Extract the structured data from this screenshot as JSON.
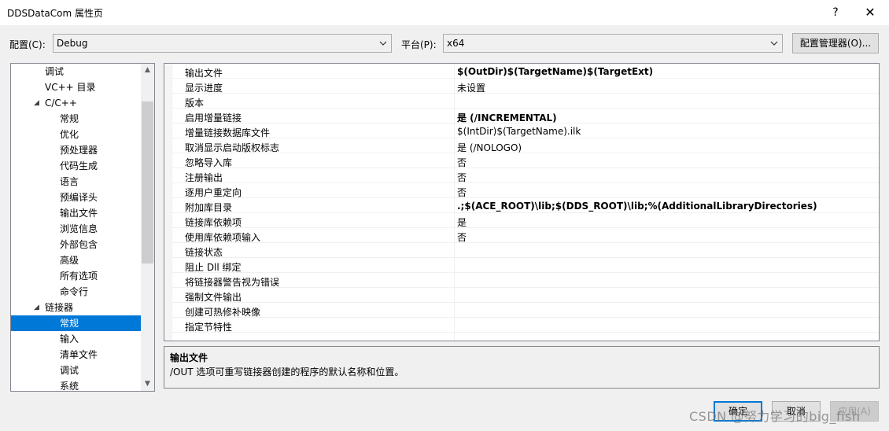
{
  "window": {
    "title": "DDSDataCom 属性页",
    "help_glyph": "?",
    "close_glyph": "✕"
  },
  "config": {
    "label": "配置(C):",
    "value": "Debug",
    "platform_label": "平台(P):",
    "platform_value": "x64",
    "manager_button": "配置管理器(O)..."
  },
  "tree": {
    "items": [
      {
        "label": "调试",
        "indent": 2,
        "expander": "",
        "selected": false
      },
      {
        "label": "VC++ 目录",
        "indent": 2,
        "expander": "",
        "selected": false
      },
      {
        "label": "C/C++",
        "indent": 2,
        "expander": "◢",
        "selected": false
      },
      {
        "label": "常规",
        "indent": 3,
        "expander": "",
        "selected": false
      },
      {
        "label": "优化",
        "indent": 3,
        "expander": "",
        "selected": false
      },
      {
        "label": "预处理器",
        "indent": 3,
        "expander": "",
        "selected": false
      },
      {
        "label": "代码生成",
        "indent": 3,
        "expander": "",
        "selected": false
      },
      {
        "label": "语言",
        "indent": 3,
        "expander": "",
        "selected": false
      },
      {
        "label": "预编译头",
        "indent": 3,
        "expander": "",
        "selected": false
      },
      {
        "label": "输出文件",
        "indent": 3,
        "expander": "",
        "selected": false
      },
      {
        "label": "浏览信息",
        "indent": 3,
        "expander": "",
        "selected": false
      },
      {
        "label": "外部包含",
        "indent": 3,
        "expander": "",
        "selected": false
      },
      {
        "label": "高级",
        "indent": 3,
        "expander": "",
        "selected": false
      },
      {
        "label": "所有选项",
        "indent": 3,
        "expander": "",
        "selected": false
      },
      {
        "label": "命令行",
        "indent": 3,
        "expander": "",
        "selected": false
      },
      {
        "label": "链接器",
        "indent": 2,
        "expander": "◢",
        "selected": false
      },
      {
        "label": "常规",
        "indent": 3,
        "expander": "",
        "selected": true
      },
      {
        "label": "输入",
        "indent": 3,
        "expander": "",
        "selected": false
      },
      {
        "label": "清单文件",
        "indent": 3,
        "expander": "",
        "selected": false
      },
      {
        "label": "调试",
        "indent": 3,
        "expander": "",
        "selected": false
      },
      {
        "label": "系统",
        "indent": 3,
        "expander": "",
        "selected": false
      }
    ],
    "scroll_up_glyph": "▲",
    "scroll_down_glyph": "▼"
  },
  "properties": [
    {
      "name": "输出文件",
      "value": "$(OutDir)$(TargetName)$(TargetExt)",
      "bold": true
    },
    {
      "name": "显示进度",
      "value": "未设置",
      "bold": false
    },
    {
      "name": "版本",
      "value": "",
      "bold": false
    },
    {
      "name": "启用增量链接",
      "value": "是 (/INCREMENTAL)",
      "bold": true
    },
    {
      "name": "增量链接数据库文件",
      "value": "$(IntDir)$(TargetName).ilk",
      "bold": false
    },
    {
      "name": "取消显示启动版权标志",
      "value": "是 (/NOLOGO)",
      "bold": false
    },
    {
      "name": "忽略导入库",
      "value": "否",
      "bold": false
    },
    {
      "name": "注册输出",
      "value": "否",
      "bold": false
    },
    {
      "name": "逐用户重定向",
      "value": "否",
      "bold": false
    },
    {
      "name": "附加库目录",
      "value": ".;$(ACE_ROOT)\\lib;$(DDS_ROOT)\\lib;%(AdditionalLibraryDirectories)",
      "bold": true
    },
    {
      "name": "链接库依赖项",
      "value": "是",
      "bold": false
    },
    {
      "name": "使用库依赖项输入",
      "value": "否",
      "bold": false
    },
    {
      "name": "链接状态",
      "value": "",
      "bold": false
    },
    {
      "name": "阻止 Dll 绑定",
      "value": "",
      "bold": false
    },
    {
      "name": "将链接器警告视为错误",
      "value": "",
      "bold": false
    },
    {
      "name": "强制文件输出",
      "value": "",
      "bold": false
    },
    {
      "name": "创建可热修补映像",
      "value": "",
      "bold": false
    },
    {
      "name": "指定节特性",
      "value": "",
      "bold": false
    }
  ],
  "description": {
    "title": "输出文件",
    "text": "/OUT 选项可重写链接器创建的程序的默认名称和位置。"
  },
  "buttons": {
    "ok": "确定",
    "cancel": "取消",
    "apply": "应用(A)"
  },
  "watermark": "CSDN @努力学习的big_fish",
  "colors": {
    "selection": "#0078d7",
    "dialog_bg": "#f0f0f0"
  }
}
